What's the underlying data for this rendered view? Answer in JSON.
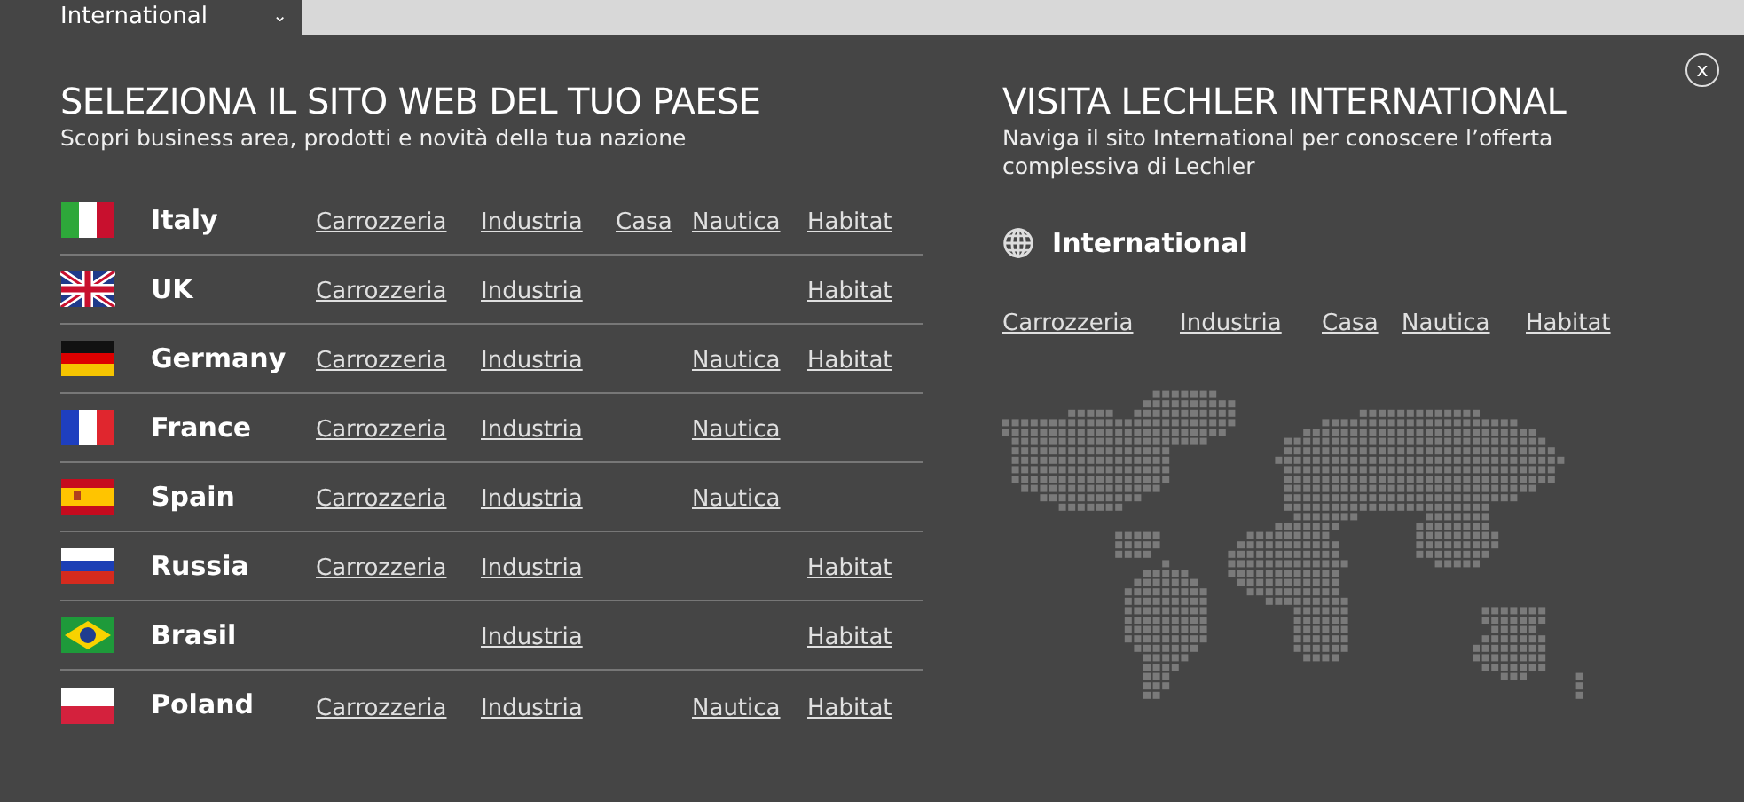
{
  "top_bar": {
    "selector": {
      "label": "International",
      "caret": "⌄"
    }
  },
  "countries_panel": {
    "title": "SELEZIONA IL SITO WEB DEL TUO PAESE",
    "subtitle": "Scopri business area, prodotti e novità della tua nazione",
    "countries": [
      {
        "name": "Italy",
        "carrozzeria": "Carrozzeria",
        "industria": "Industria",
        "casa": "Casa",
        "nautica": "Nautica",
        "habitat": "Habitat"
      },
      {
        "name": "UK",
        "carrozzeria": "Carrozzeria",
        "industria": "Industria",
        "habitat": "Habitat"
      },
      {
        "name": "Germany",
        "carrozzeria": "Carrozzeria",
        "industria": "Industria",
        "nautica": "Nautica",
        "habitat": "Habitat"
      },
      {
        "name": "France",
        "carrozzeria": "Carrozzeria",
        "industria": "Industria",
        "nautica": "Nautica"
      },
      {
        "name": "Spain",
        "carrozzeria": "Carrozzeria",
        "industria": "Industria",
        "nautica": "Nautica"
      },
      {
        "name": "Russia",
        "carrozzeria": "Carrozzeria",
        "industria": "Industria",
        "habitat": "Habitat"
      },
      {
        "name": "Brasil",
        "industria": "Industria",
        "habitat": "Habitat"
      },
      {
        "name": "Poland",
        "carrozzeria": "Carrozzeria",
        "industria": "Industria",
        "nautica": "Nautica",
        "habitat": "Habitat"
      }
    ]
  },
  "international_panel": {
    "close": "x",
    "title": "VISITA LECHLER INTERNATIONAL",
    "subtitle": "Naviga il sito International per conoscere l’offerta complessiva di Lechler",
    "site": "International",
    "links": [
      "Carrozzeria",
      "Industria",
      "Casa",
      "Nautica",
      "Habitat"
    ]
  }
}
